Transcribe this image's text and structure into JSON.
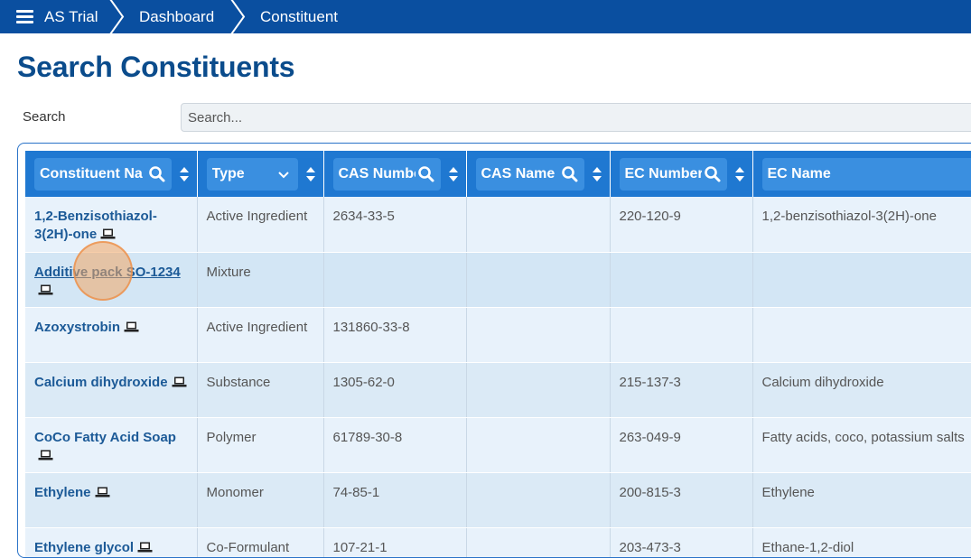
{
  "breadcrumb": {
    "home": "AS Trial",
    "items": [
      "Dashboard",
      "Constituent"
    ]
  },
  "page": {
    "title": "Search Constituents"
  },
  "search": {
    "label": "Search",
    "placeholder": "Search...",
    "value": ""
  },
  "table": {
    "columns": [
      {
        "label": "Constituent Na",
        "filter_icon": "search-icon"
      },
      {
        "label": "Type",
        "filter_icon": "chevron-down-icon"
      },
      {
        "label": "CAS Numbe",
        "filter_icon": "search-icon"
      },
      {
        "label": "CAS Name",
        "filter_icon": "search-icon"
      },
      {
        "label": "EC Number",
        "filter_icon": "search-icon"
      },
      {
        "label": "EC Name",
        "filter_icon": ""
      }
    ],
    "rows": [
      {
        "name": "1,2-Benzisothiazol-3(2H)-one",
        "type": "Active Ingredient",
        "cas_number": "2634-33-5",
        "cas_name": "",
        "ec_number": "220-120-9",
        "ec_name": "1,2-benzisothiazol-3(2H)-one"
      },
      {
        "name": "Additive pack SO-1234",
        "type": "Mixture",
        "cas_number": "",
        "cas_name": "",
        "ec_number": "",
        "ec_name": ""
      },
      {
        "name": "Azoxystrobin",
        "type": "Active Ingredient",
        "cas_number": "131860-33-8",
        "cas_name": "",
        "ec_number": "",
        "ec_name": ""
      },
      {
        "name": "Calcium dihydroxide",
        "type": "Substance",
        "cas_number": "1305-62-0",
        "cas_name": "",
        "ec_number": "215-137-3",
        "ec_name": "Calcium dihydroxide"
      },
      {
        "name": "CoCo Fatty Acid Soap",
        "type": "Polymer",
        "cas_number": "61789-30-8",
        "cas_name": "",
        "ec_number": "263-049-9",
        "ec_name": "Fatty acids, coco, potassium salts"
      },
      {
        "name": "Ethylene",
        "type": "Monomer",
        "cas_number": "74-85-1",
        "cas_name": "",
        "ec_number": "200-815-3",
        "ec_name": "Ethylene"
      },
      {
        "name": "Ethylene glycol",
        "type": "Co-Formulant",
        "cas_number": "107-21-1",
        "cas_name": "",
        "ec_number": "203-473-3",
        "ec_name": "Ethane-1,2-diol"
      }
    ]
  },
  "colors": {
    "topbar": "#0a4fa0",
    "title": "#0b4c8c",
    "header": "#1f78d1",
    "link": "#1c5a97",
    "highlight": "#f3a663"
  }
}
